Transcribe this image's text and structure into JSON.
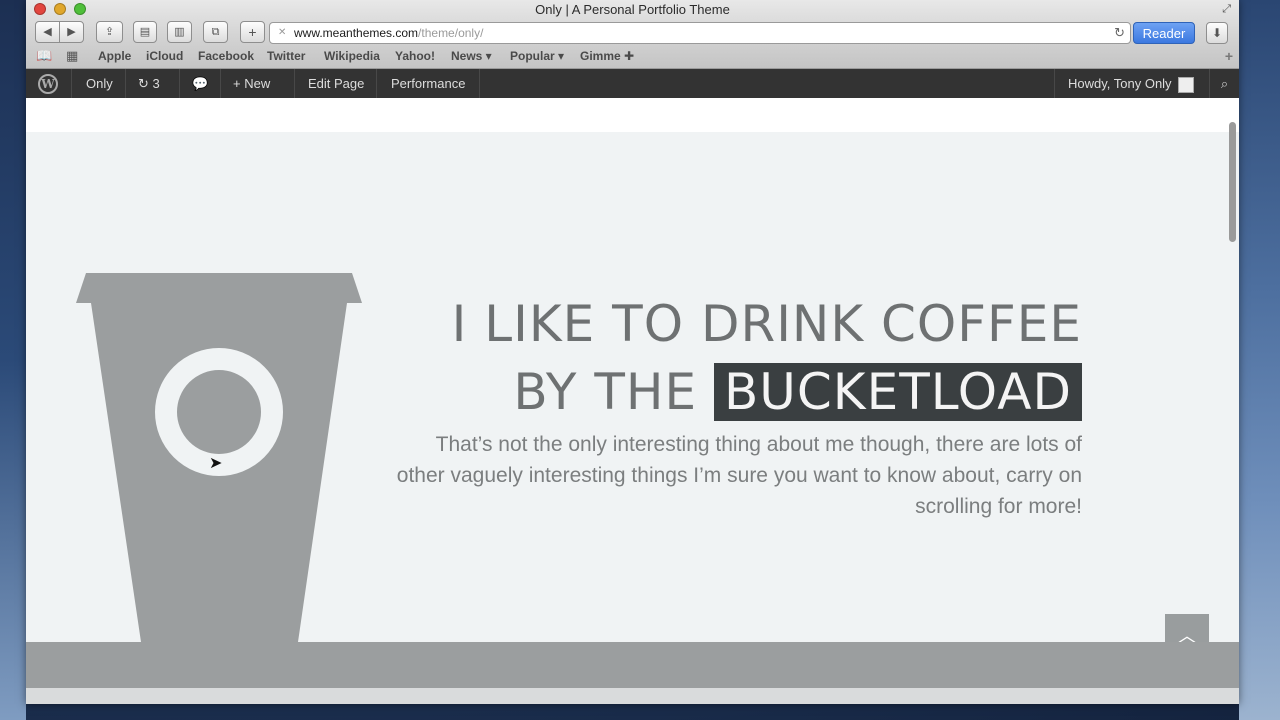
{
  "window": {
    "title": "Only | A Personal Portfolio Theme"
  },
  "toolbar": {
    "back": "◀",
    "forward": "▶",
    "share": "⇪",
    "bookmarks": "▤",
    "reading_list": "▥",
    "tabs": "⧉",
    "add": "+",
    "url_host": "www.meanthemes.com",
    "url_path": "/theme/only/",
    "reload": "↻",
    "reader": "Reader",
    "downloads": "⬇"
  },
  "bookmarks": {
    "items": [
      "Apple",
      "iCloud",
      "Facebook",
      "Twitter",
      "Wikipedia",
      "Yahoo!",
      "News ▾",
      "Popular ▾",
      "Gimme ✚"
    ],
    "new_tab": "+"
  },
  "adminbar": {
    "wp_logo": "W",
    "site": "Only",
    "updates": "↻ 3",
    "comments": "💬",
    "new": "+ New",
    "edit": "Edit Page",
    "performance": "Performance",
    "howdy": "Howdy, Tony Only",
    "search": "⌕"
  },
  "hero": {
    "line1": "I LIKE TO DRINK COFFEE",
    "line2_prefix": "BY THE",
    "line2_highlight": "BUCKETLOAD",
    "intro": "That’s not the only interesting thing about me though, there are lots of other vaguely interesting things I’m sure you want to know about, carry on scrolling for more!",
    "to_top": "︿"
  },
  "colors": {
    "hero_bg": "#f0f3f4",
    "cup": "#9b9e9f",
    "highlight_bg": "#3a3f41",
    "admin_bg": "#333333",
    "reader": "#3b78e0"
  }
}
